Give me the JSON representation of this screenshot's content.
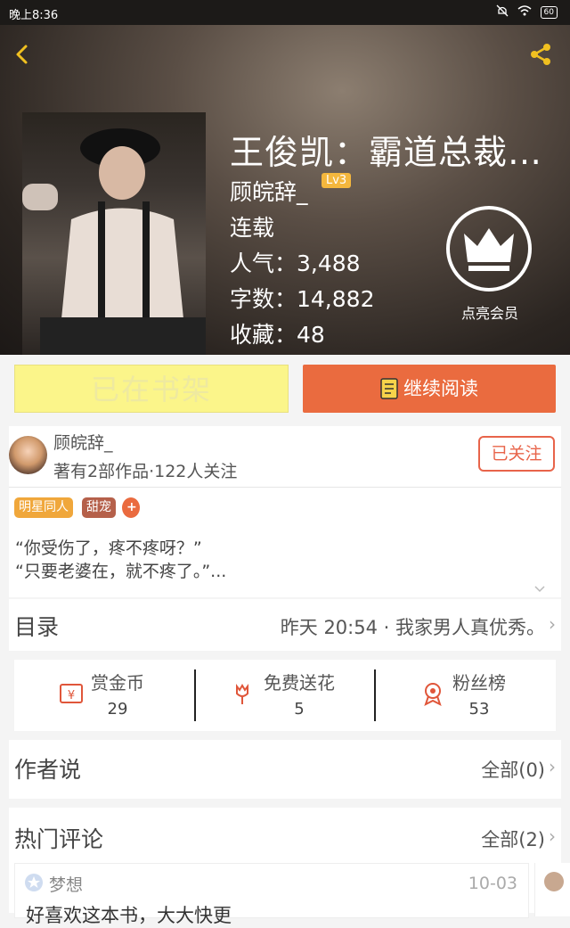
{
  "status_bar": {
    "time": "晚上8:36",
    "battery": "60"
  },
  "book": {
    "title": "王俊凯：霸道总裁…",
    "author": "顾皖辞_",
    "level": "Lv3",
    "status": "连载",
    "popularity": "人气：3,488",
    "word_count": "字数：14,882",
    "favorites": "收藏：48"
  },
  "vip": {
    "label": "点亮会员"
  },
  "actions": {
    "shelf_label": "已在书架",
    "read_label": "继续阅读"
  },
  "author_info": {
    "name": "顾皖辞_",
    "stats": "著有2部作品·122人关注",
    "follow_label": "已关注"
  },
  "tags": [
    "明星同人",
    "甜宠",
    "+"
  ],
  "excerpt": {
    "line1": "“你受伤了，疼不疼呀？”",
    "line2": "“只要老婆在，就不疼了。”..."
  },
  "toc": {
    "label": "目录",
    "latest": "昨天 20:54 · 我家男人真优秀。"
  },
  "stats": [
    {
      "label": "赏金币",
      "value": "29",
      "icon": "money-icon"
    },
    {
      "label": "免费送花",
      "value": "5",
      "icon": "flower-icon"
    },
    {
      "label": "粉丝榜",
      "value": "53",
      "icon": "ribbon-icon"
    }
  ],
  "author_says": {
    "label": "作者说",
    "count": "全部(0)"
  },
  "hot_comments": {
    "label": "热门评论",
    "count": "全部(2)",
    "first": {
      "user": "梦想",
      "date": "10-03",
      "text": "好喜欢这本书，大大快更"
    }
  },
  "colors": {
    "accent": "#ea6b3f",
    "shelf_bg": "#fbf58a",
    "tag_orange": "#f0a73b",
    "tag_brown": "#b5604a"
  }
}
